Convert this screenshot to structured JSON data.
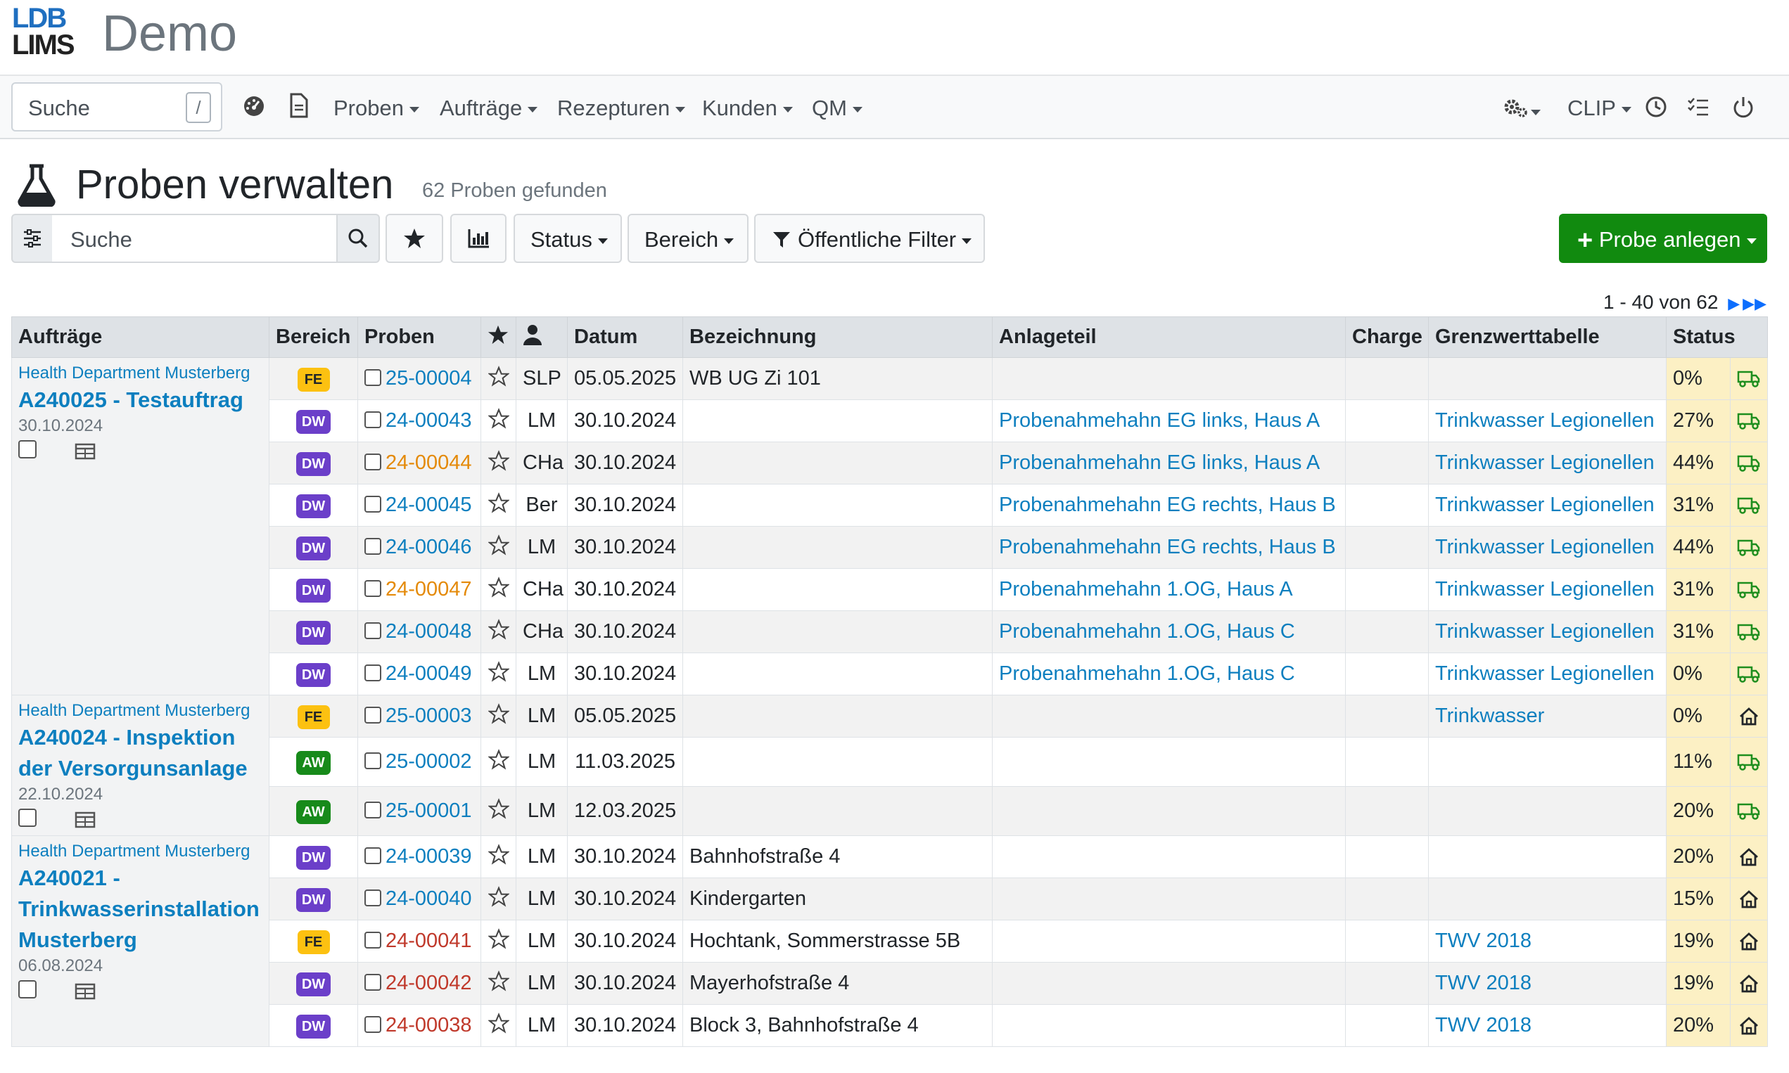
{
  "brand": {
    "logo_line1": "LDB",
    "logo_line2": "LIMS",
    "app_title": "Demo"
  },
  "nav": {
    "search_placeholder": "Suche",
    "search_shortcut": "/",
    "menus": [
      "Proben",
      "Aufträge",
      "Rezepturen",
      "Kunden",
      "QM"
    ],
    "user": "CLIP",
    "icons": [
      "dashboard-icon",
      "document-icon",
      "settings-icon",
      "clock-icon",
      "tasks-icon",
      "power-icon"
    ]
  },
  "page": {
    "title": "Proben verwalten",
    "count": "62 Proben gefunden"
  },
  "toolbar": {
    "search_placeholder": "Suche",
    "status": "Status",
    "bereich": "Bereich",
    "public_filter": "Öffentliche Filter",
    "add": "Probe anlegen"
  },
  "pagination": {
    "text": "1 - 40 von 62"
  },
  "table": {
    "headers": {
      "auftraege": "Aufträge",
      "bereich": "Bereich",
      "proben": "Proben",
      "datum": "Datum",
      "bezeichnung": "Bezeichnung",
      "anlageteil": "Anlageteil",
      "charge": "Charge",
      "grenzwert": "Grenzwerttabelle",
      "status": "Status"
    },
    "orders": [
      {
        "client": "Health Department Musterberg",
        "title": "A240025 - Testauftrag",
        "date": "30.10.2024"
      },
      {
        "client": "Health Department Musterberg",
        "title": "A240024 - Inspektion der Versorgunsanlage",
        "date": "22.10.2024"
      },
      {
        "client": "Health Department Musterberg",
        "title": "A240021 - Trinkwasserinstallation Musterberg",
        "date": "06.08.2024"
      }
    ],
    "rows": [
      {
        "bereich": "FE",
        "id": "25-00004",
        "user": "SLP",
        "datum": "05.05.2025",
        "bez": "WB UG Zi 101",
        "anlage": "",
        "charge": "",
        "grenz": "",
        "pct": "0%",
        "icon": "truck"
      },
      {
        "bereich": "DW",
        "id": "24-00043",
        "user": "LM",
        "datum": "30.10.2024",
        "bez": "",
        "anlage": "Probenahmehahn EG links, Haus A",
        "charge": "",
        "grenz": "Trinkwasser Legionellen",
        "pct": "27%",
        "icon": "truck"
      },
      {
        "bereich": "DW",
        "id": "24-00044",
        "user": "CHa",
        "datum": "30.10.2024",
        "bez": "",
        "anlage": "Probenahmehahn EG links, Haus A",
        "charge": "",
        "grenz": "Trinkwasser Legionellen",
        "pct": "44%",
        "icon": "truck"
      },
      {
        "bereich": "DW",
        "id": "24-00045",
        "user": "Ber",
        "datum": "30.10.2024",
        "bez": "",
        "anlage": "Probenahmehahn EG rechts, Haus B",
        "charge": "",
        "grenz": "Trinkwasser Legionellen",
        "pct": "31%",
        "icon": "truck"
      },
      {
        "bereich": "DW",
        "id": "24-00046",
        "user": "LM",
        "datum": "30.10.2024",
        "bez": "",
        "anlage": "Probenahmehahn EG rechts, Haus B",
        "charge": "",
        "grenz": "Trinkwasser Legionellen",
        "pct": "44%",
        "icon": "truck"
      },
      {
        "bereich": "DW",
        "id": "24-00047",
        "user": "CHa",
        "datum": "30.10.2024",
        "bez": "",
        "anlage": "Probenahmehahn 1.OG, Haus A",
        "charge": "",
        "grenz": "Trinkwasser Legionellen",
        "pct": "31%",
        "icon": "truck"
      },
      {
        "bereich": "DW",
        "id": "24-00048",
        "user": "CHa",
        "datum": "30.10.2024",
        "bez": "",
        "anlage": "Probenahmehahn 1.OG, Haus C",
        "charge": "",
        "grenz": "Trinkwasser Legionellen",
        "pct": "31%",
        "icon": "truck"
      },
      {
        "bereich": "DW",
        "id": "24-00049",
        "user": "LM",
        "datum": "30.10.2024",
        "bez": "",
        "anlage": "Probenahmehahn 1.OG, Haus C",
        "charge": "",
        "grenz": "Trinkwasser Legionellen",
        "pct": "0%",
        "icon": "truck"
      },
      {
        "bereich": "FE",
        "id": "25-00003",
        "user": "LM",
        "datum": "05.05.2025",
        "bez": "",
        "anlage": "",
        "charge": "",
        "grenz": "Trinkwasser",
        "pct": "0%",
        "icon": "home"
      },
      {
        "bereich": "AW",
        "id": "25-00002",
        "user": "LM",
        "datum": "11.03.2025",
        "bez": "",
        "anlage": "",
        "charge": "",
        "grenz": "",
        "pct": "11%",
        "icon": "truck"
      },
      {
        "bereich": "AW",
        "id": "25-00001",
        "user": "LM",
        "datum": "12.03.2025",
        "bez": "",
        "anlage": "",
        "charge": "",
        "grenz": "",
        "pct": "20%",
        "icon": "truck"
      },
      {
        "bereich": "DW",
        "id": "24-00039",
        "user": "LM",
        "datum": "30.10.2024",
        "bez": "Bahnhofstraße 4",
        "anlage": "",
        "charge": "",
        "grenz": "",
        "pct": "20%",
        "icon": "home"
      },
      {
        "bereich": "DW",
        "id": "24-00040",
        "user": "LM",
        "datum": "30.10.2024",
        "bez": "Kindergarten",
        "anlage": "",
        "charge": "",
        "grenz": "",
        "pct": "15%",
        "icon": "home"
      },
      {
        "bereich": "FE",
        "id": "24-00041",
        "user": "LM",
        "datum": "30.10.2024",
        "bez": "Hochtank, Sommerstrasse 5B",
        "anlage": "",
        "charge": "",
        "grenz": "TWV 2018",
        "pct": "19%",
        "icon": "home"
      },
      {
        "bereich": "DW",
        "id": "24-00042",
        "user": "LM",
        "datum": "30.10.2024",
        "bez": "Mayerhofstraße 4",
        "anlage": "",
        "charge": "",
        "grenz": "TWV 2018",
        "pct": "19%",
        "icon": "home"
      },
      {
        "bereich": "DW",
        "id": "24-00038",
        "user": "LM",
        "datum": "30.10.2024",
        "bez": "Block 3, Bahnhofstraße 4",
        "anlage": "",
        "charge": "",
        "grenz": "TWV 2018",
        "pct": "20%",
        "icon": "home"
      }
    ]
  },
  "colors": {
    "brand_green": "#118a0f",
    "link": "#0d7fbf",
    "status_bg": "#fcf0c4",
    "truck": "#1e8e1e"
  }
}
